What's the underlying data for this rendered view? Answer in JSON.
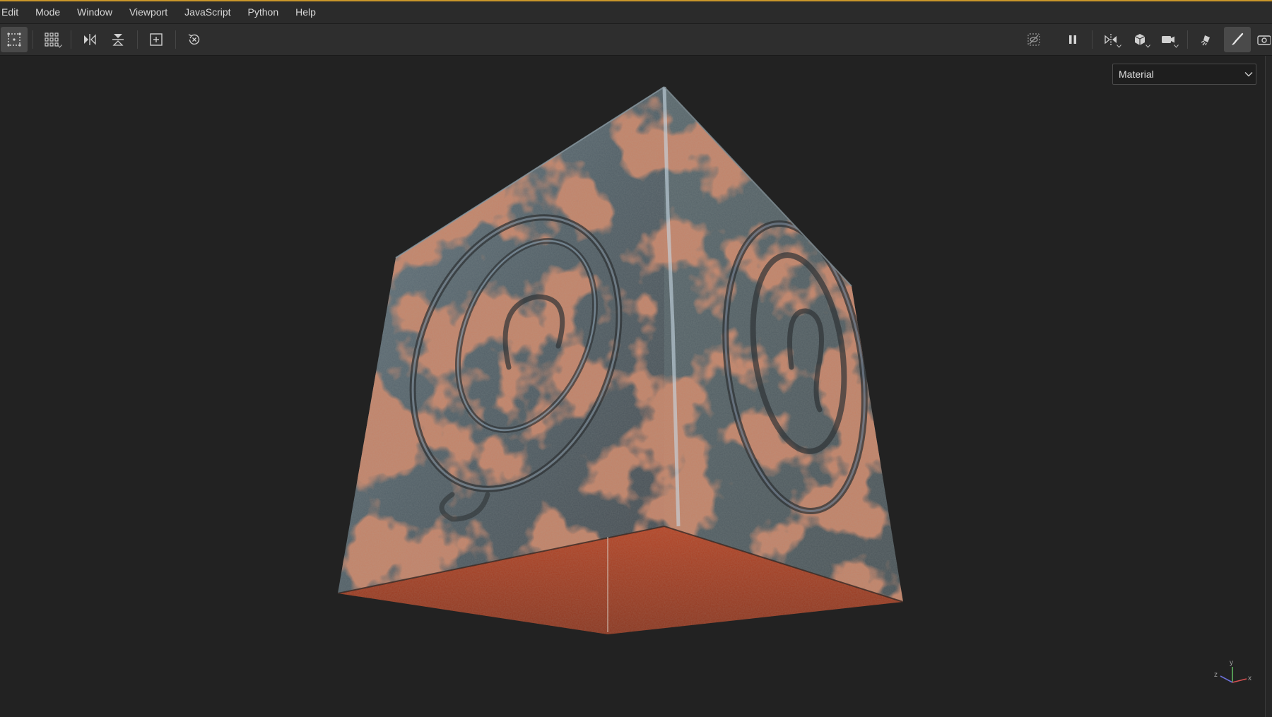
{
  "menubar": {
    "items": [
      "Edit",
      "Mode",
      "Window",
      "Viewport",
      "JavaScript",
      "Python",
      "Help"
    ]
  },
  "toolbar": {
    "left_tools": [
      "selection-grid",
      "grid-options",
      "mirror-horizontal",
      "mirror-vertical",
      "frame-selection",
      "reset-view"
    ],
    "right_tools": [
      "hide-ui",
      "pause",
      "symmetry",
      "object-display",
      "camera",
      "lights",
      "paint-brush",
      "screenshot"
    ],
    "active_tools": [
      "selection-grid",
      "paint-brush"
    ]
  },
  "viewport": {
    "shading_mode": "Material",
    "object": "rusted-metal-cube",
    "axis_labels": {
      "x": "x",
      "y": "y",
      "z": "z"
    }
  },
  "colors": {
    "accent": "#c9962a",
    "background": "#222222",
    "rust": "#a8452a",
    "steel": "#6f7c80"
  }
}
